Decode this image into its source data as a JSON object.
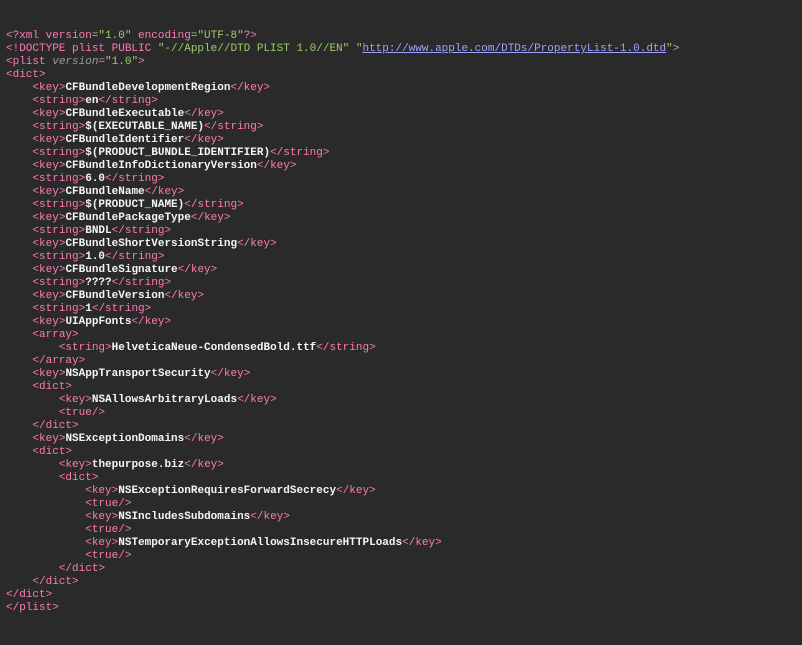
{
  "h1a": "<?",
  "h1b": "xml version",
  "h1c": "=\"1.0\"",
  "h1d": " encoding",
  "h1e": "=\"UTF-8\"",
  "h1f": "?>",
  "h2a": "<!DOCTYPE plist PUBLIC ",
  "h2b": "\"-//Apple//DTD PLIST 1.0//EN\" \"",
  "h2c": "http://www.apple.com/DTDs/PropertyList-1.0.dtd",
  "h2d": "\">",
  "h3a": "<",
  "h3b": "plist ",
  "h3c": "version",
  "h3d": "=",
  "h3e": "\"1.0\"",
  "h3f": ">",
  "ko": "<",
  "kn": "key",
  "kc": ">",
  "kcl": "</",
  "so": "<",
  "sn": "string",
  "sc": ">",
  "scl": "</",
  "ao": "<",
  "an": "array",
  "ac": ">",
  "acl": "</",
  "do": "<",
  "dn": "dict",
  "dc": ">",
  "dcl": "</",
  "to": "<",
  "tn": "true",
  "tsc": "/>",
  "po": "</",
  "pn": "plist",
  "pc": ">",
  "k1": "CFBundleDevelopmentRegion",
  "v1": "en",
  "k2": "CFBundleExecutable",
  "v2": "$(EXECUTABLE_NAME)",
  "k3": "CFBundleIdentifier",
  "v3": "$(PRODUCT_BUNDLE_IDENTIFIER)",
  "k4": "CFBundleInfoDictionaryVersion",
  "v4": "6.0",
  "k5": "CFBundleName",
  "v5": "$(PRODUCT_NAME)",
  "k6": "CFBundlePackageType",
  "v6": "BNDL",
  "k7": "CFBundleShortVersionString",
  "v7": "1.0",
  "k8": "CFBundleSignature",
  "v8": "????",
  "k9": "CFBundleVersion",
  "v9": "1",
  "k10": "UIAppFonts",
  "v10": "HelveticaNeue-CondensedBold.ttf",
  "k11": "NSAppTransportSecurity",
  "k12": "NSAllowsArbitraryLoads",
  "k13": "NSExceptionDomains",
  "k14": "thepurpose.biz",
  "k15": "NSExceptionRequiresForwardSecrecy",
  "k16": "NSIncludesSubdomains",
  "k17": "NSTemporaryExceptionAllowsInsecureHTTPLoads"
}
